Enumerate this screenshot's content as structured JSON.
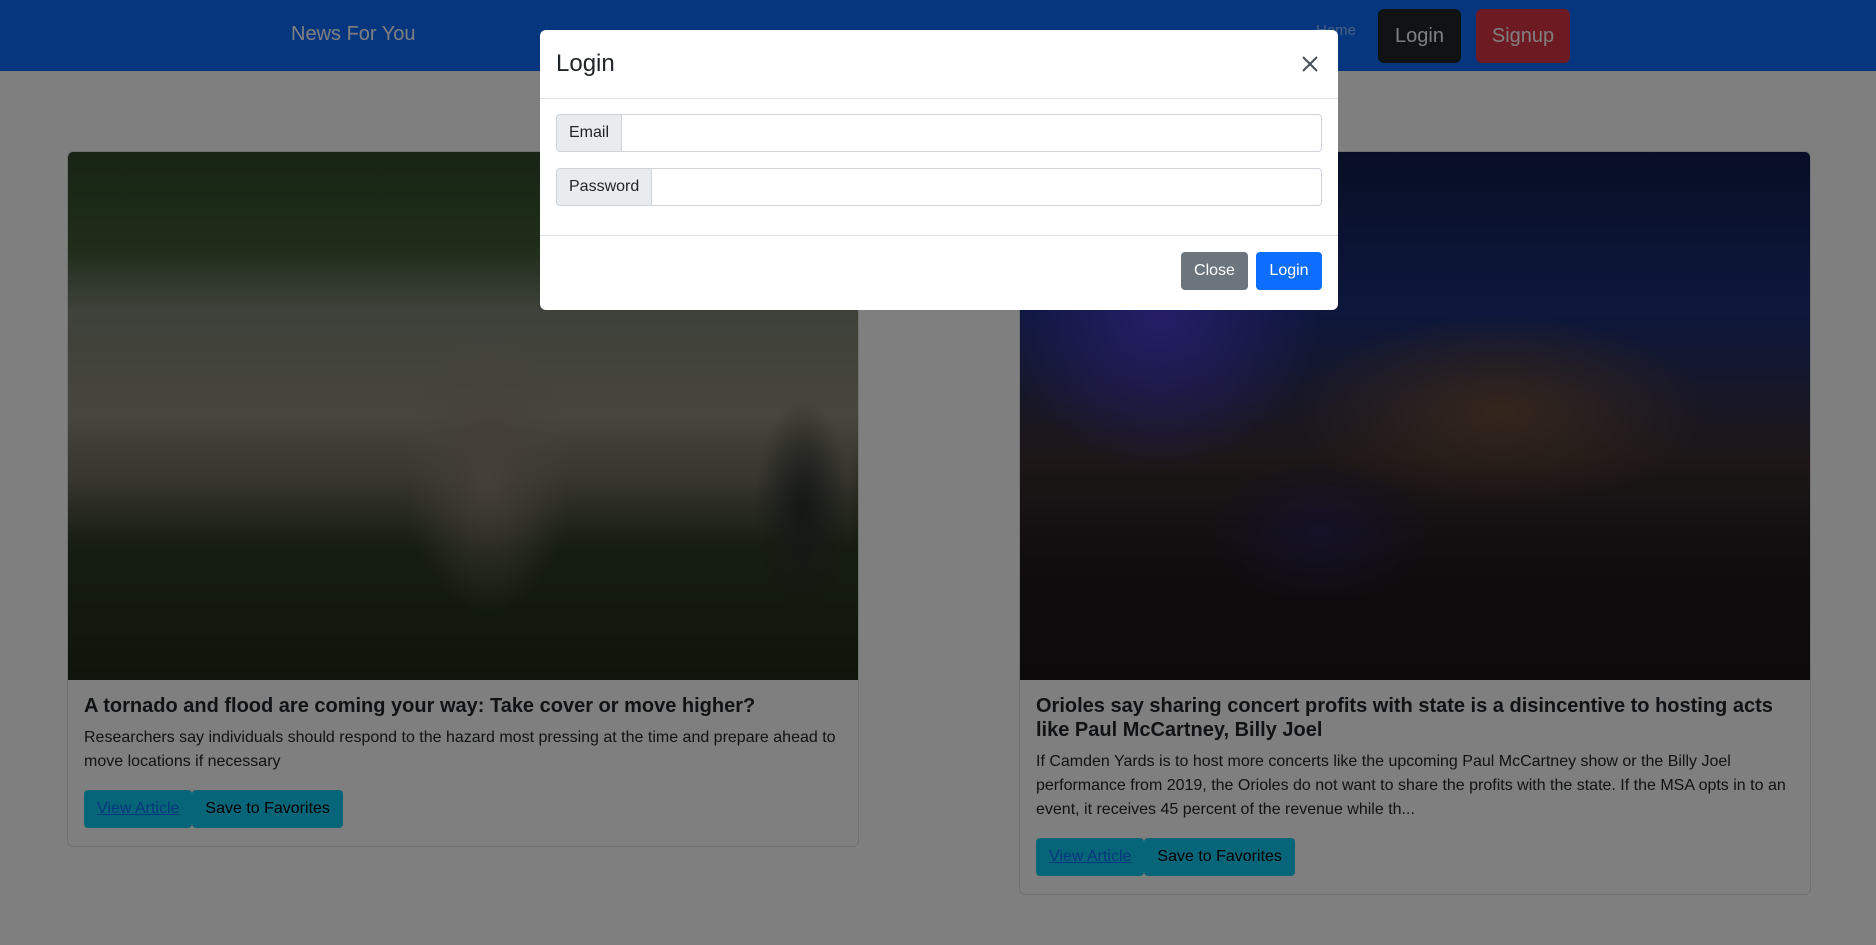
{
  "navbar": {
    "brand": "News For You",
    "home_label": "Home",
    "login_label": "Login",
    "signup_label": "Signup"
  },
  "articles": [
    {
      "title": "A tornado and flood are coming your way: Take cover or move higher?",
      "description": "Researchers say individuals should respond to the hazard most pressing at the time and prepare ahead to move locations if necessary",
      "view_label": "View Article",
      "save_label": "Save to Favorites"
    },
    {
      "title": "Orioles say sharing concert profits with state is a disincentive to hosting acts like Paul McCartney, Billy Joel",
      "description": "If Camden Yards is to host more concerts like the upcoming Paul McCartney show or the Billy Joel performance from 2019, the Orioles do not want to share the profits with the state. If the MSA opts in to an event, it receives 45 percent of the revenue while th...",
      "view_label": "View Article",
      "save_label": "Save to Favorites"
    }
  ],
  "modal": {
    "title": "Login",
    "email_label": "Email",
    "email_value": "",
    "password_label": "Password",
    "password_value": "",
    "close_label": "Close",
    "login_label": "Login"
  },
  "colors": {
    "navbar": "#0d6efd",
    "login_nav": "#212529",
    "signup_nav": "#dc3545",
    "info": "#0dcaf0",
    "secondary": "#6c757d",
    "primary": "#0d6efd"
  }
}
